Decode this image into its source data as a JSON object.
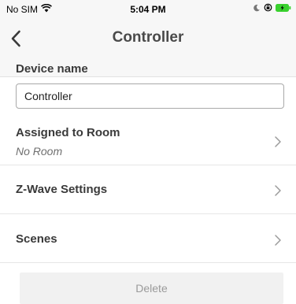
{
  "status_bar": {
    "carrier": "No SIM",
    "time": "5:04 PM"
  },
  "nav": {
    "title": "Controller"
  },
  "device": {
    "label": "Device name",
    "value": "Controller"
  },
  "rows": [
    {
      "title": "Assigned to Room",
      "subtitle": "No Room"
    },
    {
      "title": "Z-Wave Settings"
    },
    {
      "title": "Scenes"
    }
  ],
  "delete_label": "Delete",
  "colors": {
    "battery": "#39d12e",
    "nav_background": "#f7f7f7",
    "divider": "#e6e6e6"
  }
}
